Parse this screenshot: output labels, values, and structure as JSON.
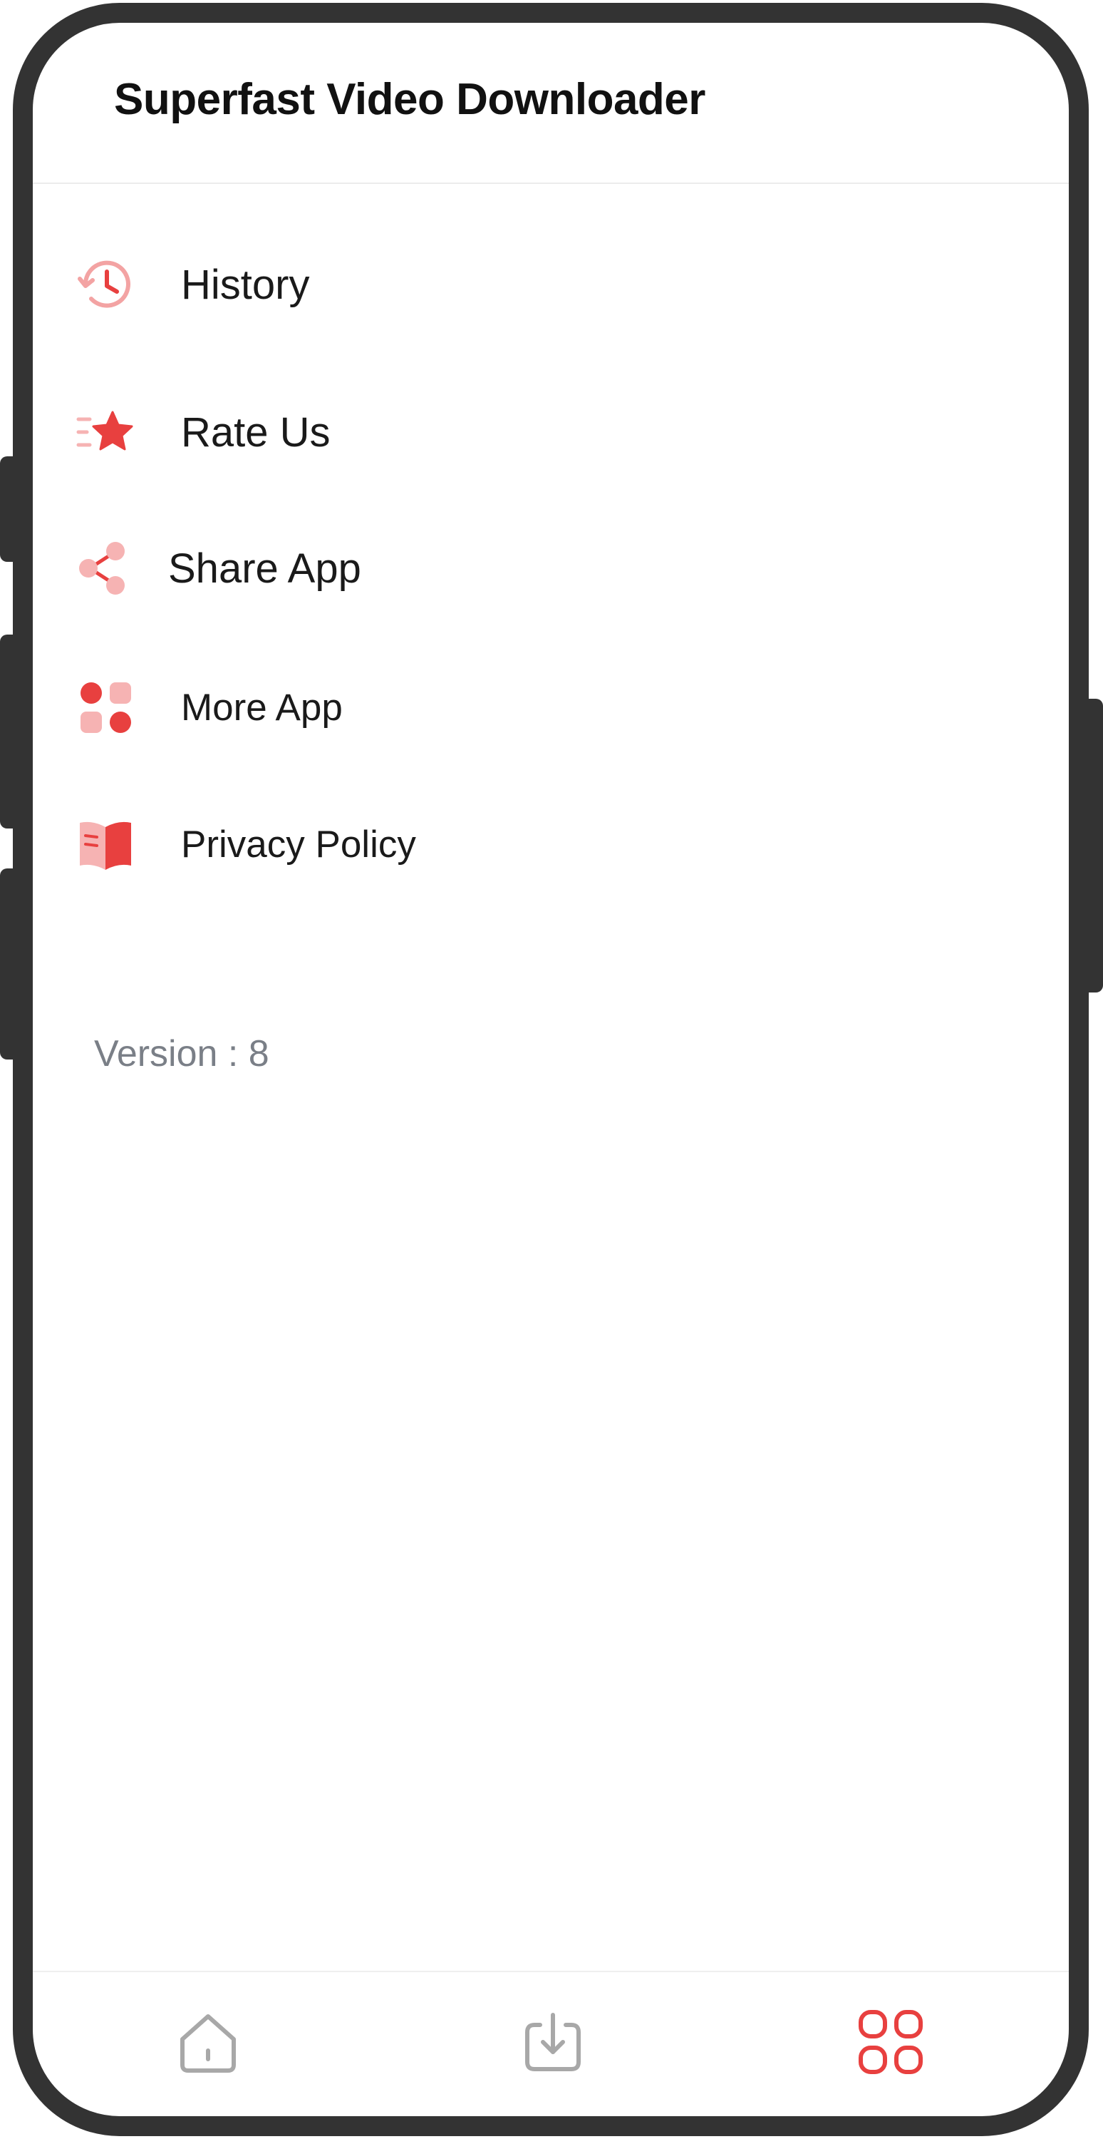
{
  "app": {
    "title": "Superfast Video Downloader"
  },
  "menu": {
    "items": [
      {
        "id": "history",
        "label": "History",
        "icon": "history-icon"
      },
      {
        "id": "rate-us",
        "label": "Rate Us",
        "icon": "star-icon"
      },
      {
        "id": "share-app",
        "label": "Share App",
        "icon": "share-icon"
      },
      {
        "id": "more-app",
        "label": "More App",
        "icon": "grid-apps-icon"
      },
      {
        "id": "privacy-policy",
        "label": "Privacy Policy",
        "icon": "book-icon"
      }
    ]
  },
  "version": {
    "label": "Version : 8"
  },
  "bottom_nav": {
    "items": [
      {
        "id": "home",
        "icon": "home-icon",
        "active": false
      },
      {
        "id": "downloads",
        "icon": "download-icon",
        "active": false
      },
      {
        "id": "more",
        "icon": "grid-icon",
        "active": true
      }
    ]
  },
  "colors": {
    "accent": "#e8403f",
    "accent_light": "#f6b3b3",
    "inactive_icon": "#a8a8a8",
    "frame": "#333333",
    "version_text": "#7a7f87"
  }
}
